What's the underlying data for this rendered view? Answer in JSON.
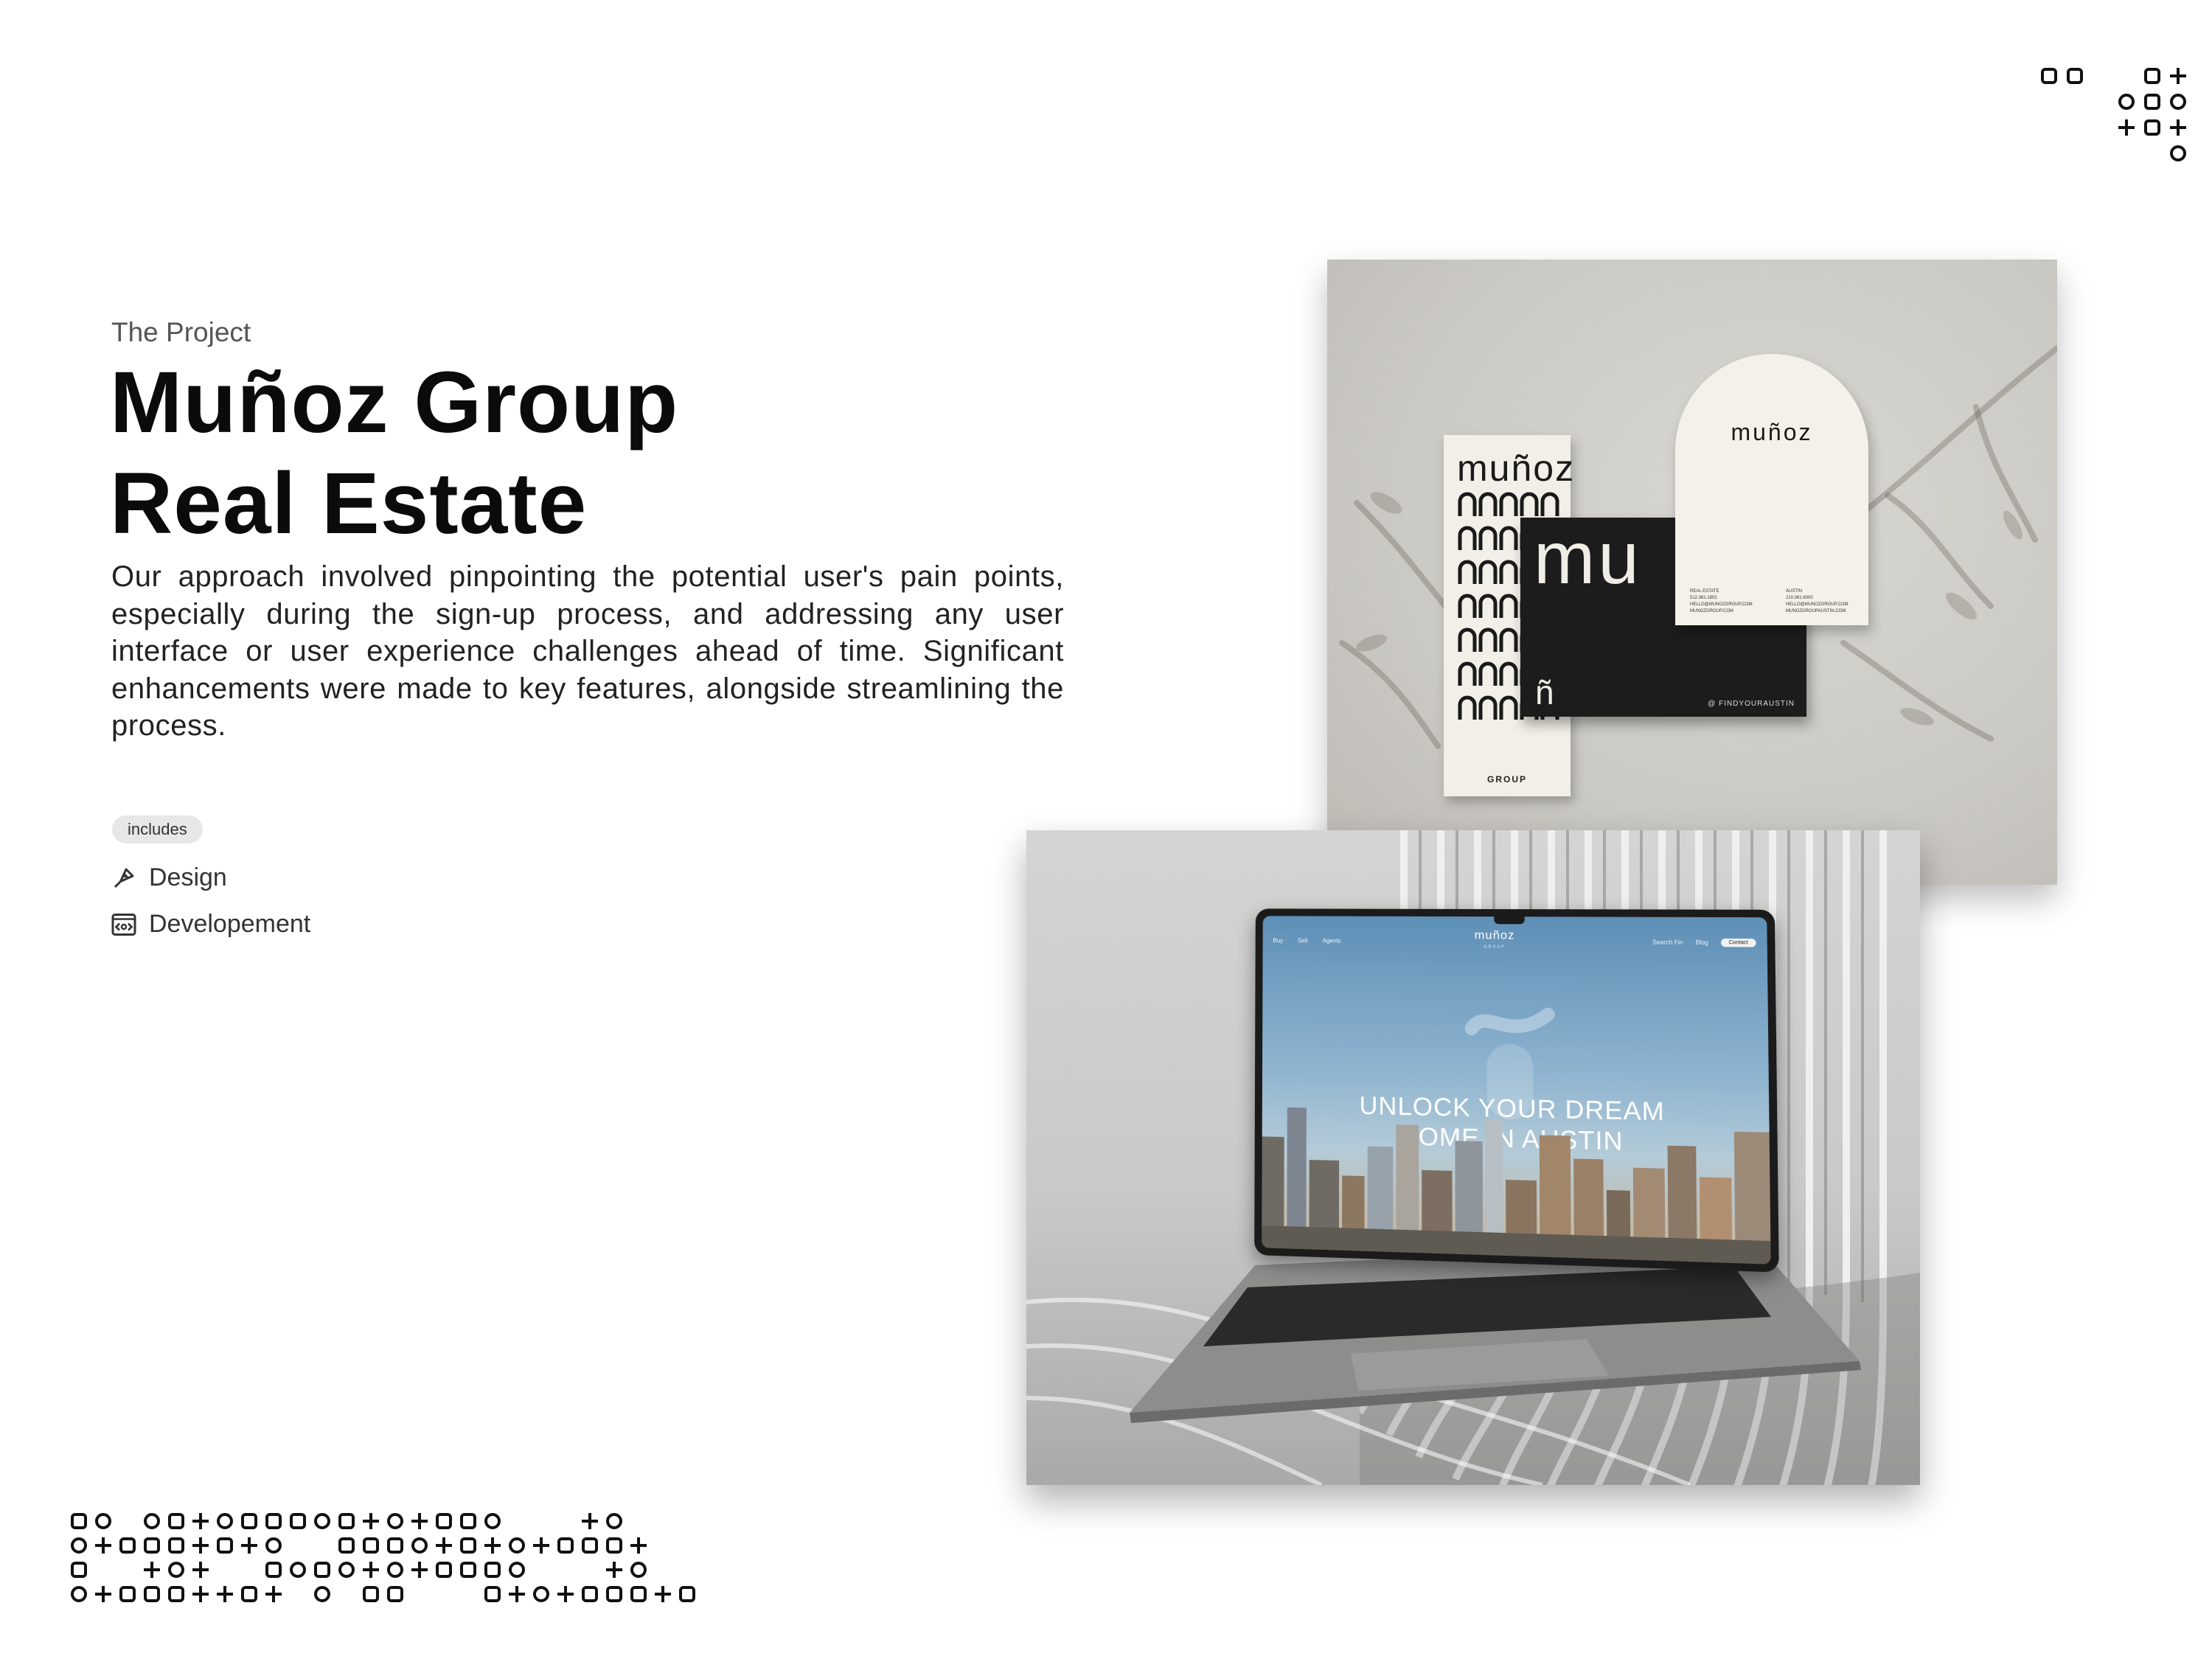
{
  "project": {
    "kicker": "The Project",
    "title_line1": "Muñoz Group",
    "title_line2": "Real Estate",
    "description": "Our approach involved pinpointing the potential user's pain points, especially during the sign-up process, and addressing any user interface or user experience challenges ahead of time. Significant enhancements were made to key features, alongside streamlining the process."
  },
  "includes": {
    "badge": "includes",
    "items": [
      {
        "label": "Design",
        "icon": "design-pen-icon"
      },
      {
        "label": "Developement",
        "icon": "development-code-icon"
      }
    ]
  },
  "stationery": {
    "tall_card_brand": "muñoz",
    "tall_card_footer": "GROUP",
    "black_card_big": "mu",
    "black_card_small": "ñ",
    "black_card_tag": "@ FINDYOURAUSTIN",
    "arch_card_brand": "muñoz",
    "arch_info_left": "REAL ESTATE\n512.361.1802\nHELLO@MUNOZGROUP.COM\nMUNOZGROUP.COM",
    "arch_info_right": "AUSTIN\n210.361.6000\nHELLO@MUNOZGROUP.COM\nMUNOZGROUPAUSTIN.COM"
  },
  "laptop": {
    "site_logo": "muñoz",
    "site_logo_sub": "GROUP",
    "nav_left": [
      "Buy",
      "Sell",
      "Agents"
    ],
    "nav_right": [
      "Search Fin",
      "Blog"
    ],
    "nav_button": "Contact",
    "hero_line1": "UNLOCK YOUR DREAM",
    "hero_line2": "HOME IN AUSTIN"
  },
  "colors": {
    "ink": "#111111",
    "badge_bg": "#e7e7e7",
    "screen_sky": "#5e8fb6"
  }
}
